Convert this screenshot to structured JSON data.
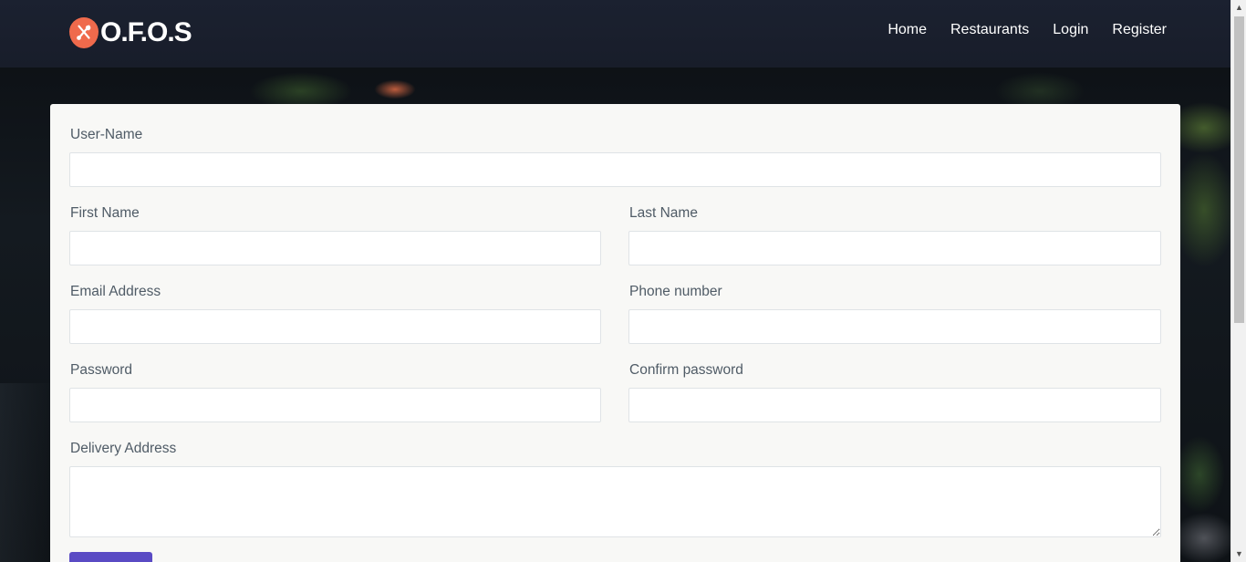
{
  "header": {
    "brand": "O.F.O.S",
    "nav": [
      {
        "label": "Home"
      },
      {
        "label": "Restaurants"
      },
      {
        "label": "Login"
      },
      {
        "label": "Register"
      }
    ]
  },
  "form": {
    "username": {
      "label": "User-Name",
      "value": ""
    },
    "first_name": {
      "label": "First Name",
      "value": ""
    },
    "last_name": {
      "label": "Last Name",
      "value": ""
    },
    "email": {
      "label": "Email Address",
      "value": ""
    },
    "phone": {
      "label": "Phone number",
      "value": ""
    },
    "password": {
      "label": "Password",
      "value": ""
    },
    "confirm_password": {
      "label": "Confirm password",
      "value": ""
    },
    "address": {
      "label": "Delivery Address",
      "value": ""
    },
    "submit_label": ""
  },
  "colors": {
    "header_bg": "#1b2130",
    "brand_accent": "#ef6a4c",
    "button": "#5a4bc4",
    "card_bg": "#f8f8f6",
    "label": "#4f5b66"
  },
  "icons": {
    "logo": "fork-spoon-icon",
    "scroll_up": "triangle-up-icon",
    "scroll_down": "triangle-down-icon"
  }
}
